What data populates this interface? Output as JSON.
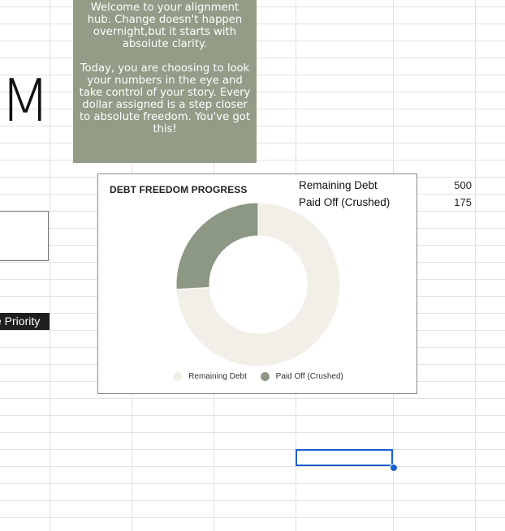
{
  "sheet": {
    "big_letter": "M",
    "priority_label": "e Priority"
  },
  "welcome_card": {
    "paragraph1": "Welcome to your alignment hub. Change doesn't happen overnight,but it starts with absolute clarity.",
    "paragraph2": "Today, you are choosing to look your numbers in the eye and take control of your story. Every dollar assigned is a step closer to absolute freedom. You've got this!"
  },
  "table": {
    "rows": [
      {
        "label": "Remaining Debt",
        "value": "500"
      },
      {
        "label": "Paid Off (Crushed)",
        "value": "175"
      }
    ]
  },
  "chart_data": {
    "type": "pie",
    "title": "DEBT FREEDOM PROGRESS",
    "donut": true,
    "categories": [
      "Remaining Debt",
      "Paid Off (Crushed)"
    ],
    "values": [
      500,
      175
    ],
    "colors": [
      "#f2efe9",
      "#8c9784"
    ],
    "legend_position": "bottom"
  },
  "colors": {
    "card_background": "#929c86",
    "selection": "#1a5fd0",
    "grid": "#e2e2e2"
  }
}
